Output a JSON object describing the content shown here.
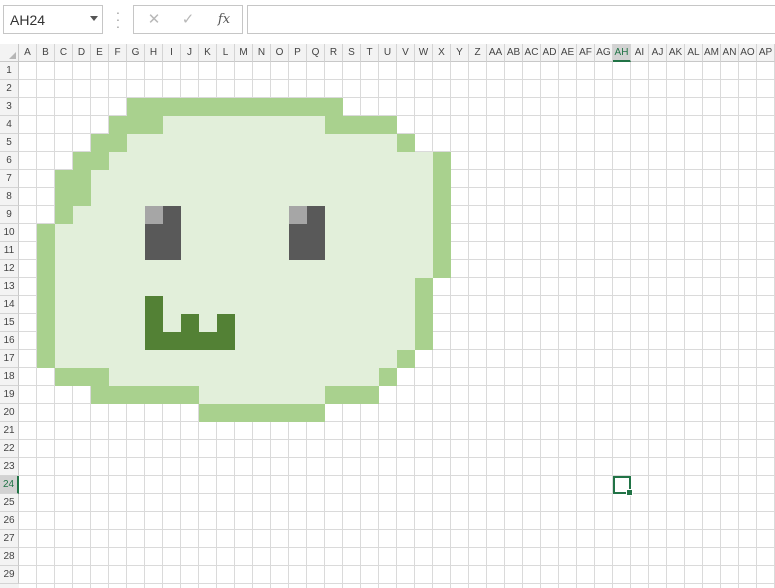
{
  "formula_bar": {
    "name_box": "AH24",
    "cancel_icon": "cancel-icon",
    "enter_icon": "enter-icon",
    "fx_label": "fx",
    "formula_value": ""
  },
  "sheet": {
    "columns": [
      "A",
      "B",
      "C",
      "D",
      "E",
      "F",
      "G",
      "H",
      "I",
      "J",
      "K",
      "L",
      "M",
      "N",
      "O",
      "P",
      "Q",
      "R",
      "S",
      "T",
      "U",
      "V",
      "W",
      "X",
      "Y",
      "Z",
      "AA",
      "AB",
      "AC",
      "AD",
      "AE",
      "AF",
      "AG",
      "AH",
      "AI",
      "AJ",
      "AK",
      "AL",
      "AM",
      "AN",
      "AO",
      "AP"
    ],
    "rows": [
      "1",
      "2",
      "3",
      "4",
      "5",
      "6",
      "7",
      "8",
      "9",
      "10",
      "11",
      "12",
      "13",
      "14",
      "15",
      "16",
      "17",
      "18",
      "19",
      "20",
      "21",
      "22",
      "23",
      "24",
      "25",
      "26",
      "27",
      "28",
      "29"
    ],
    "active_cell": {
      "col": "AH",
      "row": "24"
    },
    "colors": {
      "outline": "#a9d18e",
      "body": "#e2efda",
      "eye": "#595959",
      "eye_highlight": "#a6a6a6",
      "mouth": "#538135",
      "grid": "#dadada",
      "accent": "#217346"
    },
    "pixel_art": {
      "col_start": "A",
      "row_start": "1",
      "legend": {
        ".": "empty",
        "o": "outline",
        "b": "body",
        "e": "eye",
        "h": "eye_highlight",
        "m": "mouth"
      },
      "rows": [
        "..........................",
        "..........................",
        "......oooooooooooo........",
        ".....ooobbbbbbbbboooo.....",
        "....oobbbbbbbbbbbbbbbo....",
        "...oobbbbbbbbbbbbbbbbbbo..",
        "..oobbbbbbbbbbbbbbbbbbbo..",
        "..oobbbbbbbbbbbbbbbbbbbo..",
        "..obbbbhebbbbbbhebbbbbbo..",
        ".obbbbbeebbbbbbeebbbbbbo..",
        ".obbbbbeebbbbbbeebbbbbbo..",
        ".obbbbbbbbbbbbbbbbbbbbbo..",
        ".obbbbbbbbbbbbbbbbbbbbo...",
        ".obbbbbmbbbbbbbbbbbbbbo...",
        ".obbbbbmbmbmbbbbbbbbbbo...",
        ".obbbbbmmmmmbbbbbbbbbbo...",
        ".obbbbbbbbbbbbbbbbbbbo....",
        "..ooobbbbbbbbbbbbbbbo.....",
        "....oooooobbbbbbbooo......",
        "..........ooooooo.........."
      ]
    }
  }
}
